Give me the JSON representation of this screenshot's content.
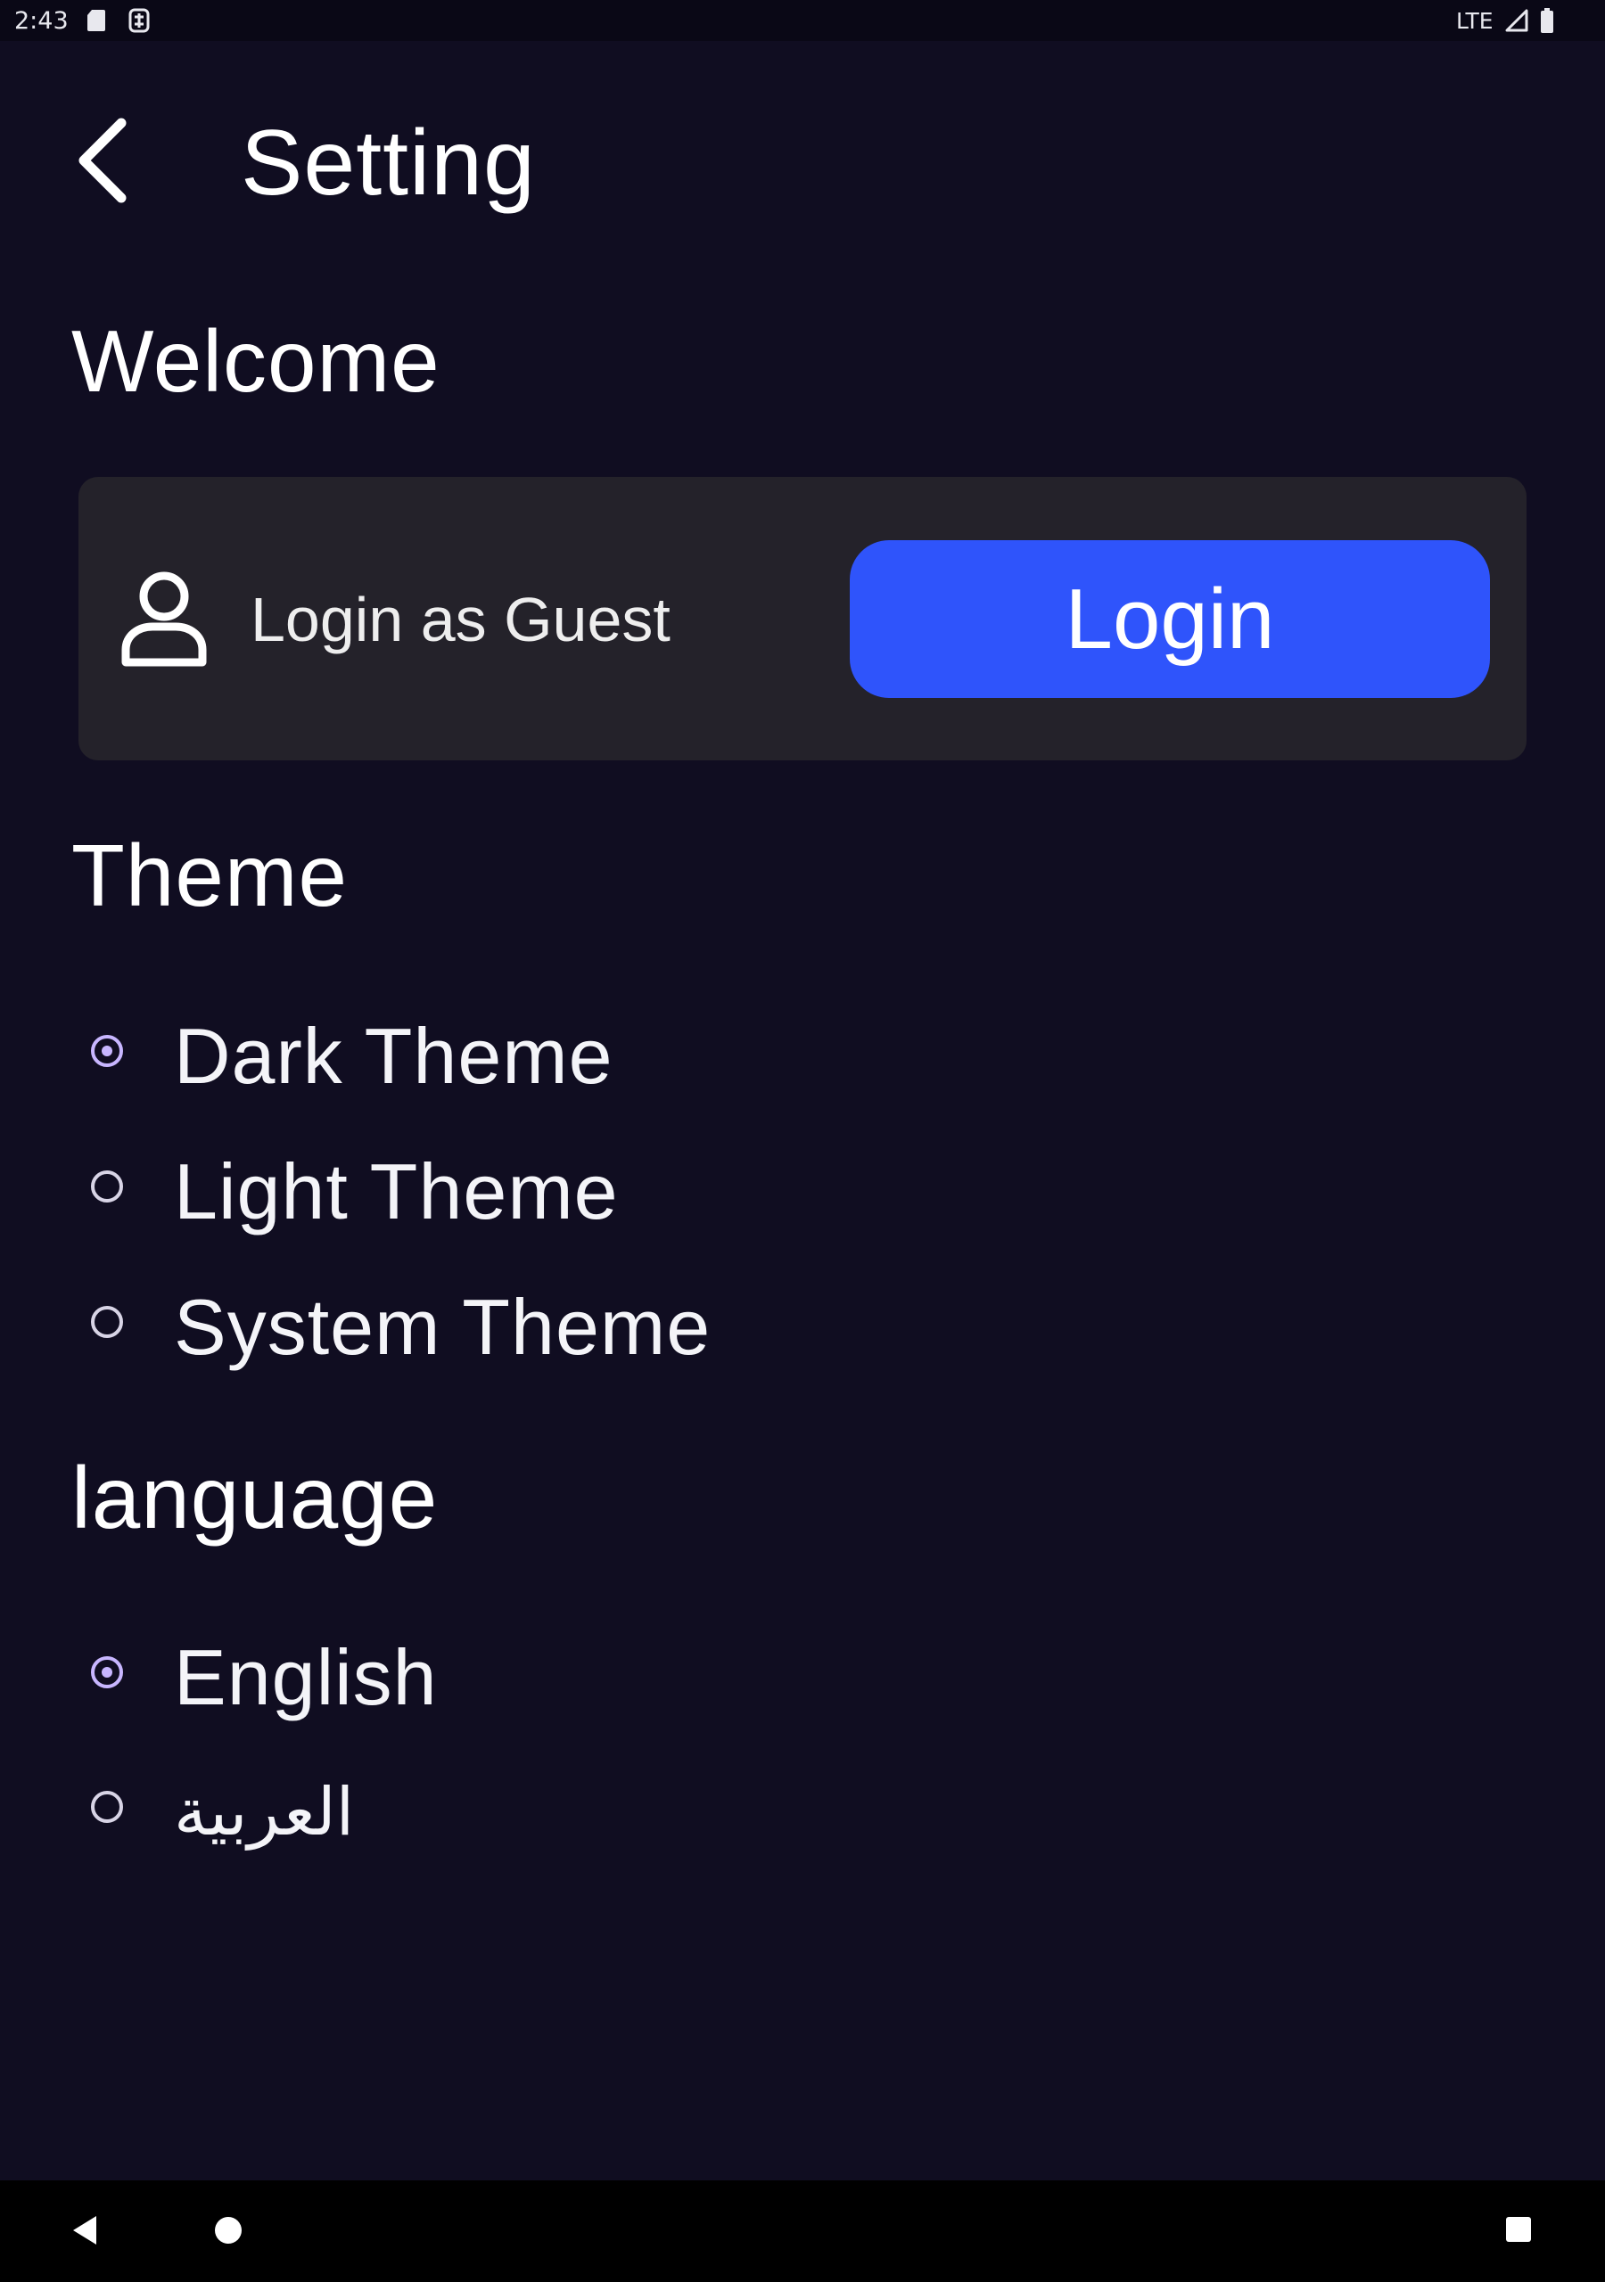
{
  "status_bar": {
    "time": "2:43",
    "network": "LTE",
    "icons": [
      "sd-card-icon",
      "sync-icon",
      "signal-icon",
      "battery-icon"
    ]
  },
  "header": {
    "back_icon": "chevron-left-icon",
    "title": "Setting"
  },
  "welcome": {
    "heading": "Welcome",
    "user_icon": "person-outline-icon",
    "guest_label": "Login as Guest",
    "login_label": "Login"
  },
  "theme": {
    "heading": "Theme",
    "options": [
      {
        "label": "Dark Theme",
        "selected": true
      },
      {
        "label": "Light Theme",
        "selected": false
      },
      {
        "label": "System Theme",
        "selected": false
      }
    ]
  },
  "language": {
    "heading": "language",
    "options": [
      {
        "label": "English",
        "selected": true
      },
      {
        "label": "العربية",
        "selected": false
      }
    ]
  },
  "nav_bar": {
    "icons": [
      "nav-back-icon",
      "nav-home-icon",
      "nav-recents-icon"
    ]
  },
  "colors": {
    "background": "#100d21",
    "card": "#24222a",
    "accent": "#2f54fb",
    "radio_selected": "#c8b6ff"
  }
}
